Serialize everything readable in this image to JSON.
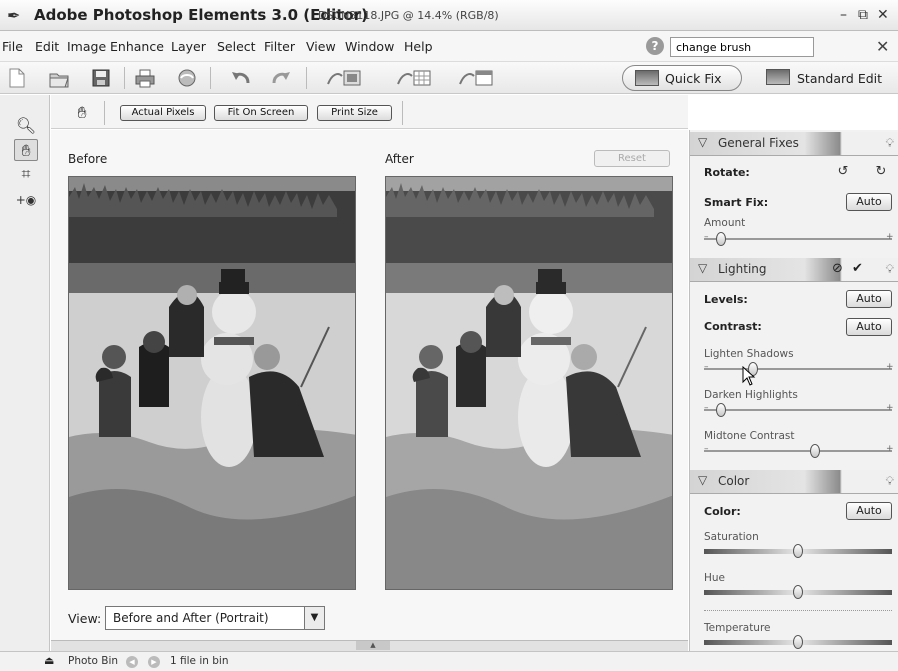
{
  "window": {
    "app_title": "Adobe Photoshop Elements 3.0 (Editor)",
    "doc_title": "DSCN3118.JPG @ 14.4% (RGB/8)"
  },
  "menu": [
    "File",
    "Edit",
    "Image",
    "Enhance",
    "Layer",
    "Select",
    "Filter",
    "View",
    "Window",
    "Help"
  ],
  "help_search": {
    "value": "change brush"
  },
  "modes": {
    "quick_fix": "Quick Fix",
    "standard_edit": "Standard Edit"
  },
  "options": {
    "actual_pixels": "Actual Pixels",
    "fit_on_screen": "Fit On Screen",
    "print_size": "Print Size"
  },
  "canvas": {
    "before_label": "Before",
    "after_label": "After",
    "reset_label": "Reset",
    "view_label": "View:",
    "view_value": "Before and After (Portrait)"
  },
  "palette": {
    "general": {
      "title": "General Fixes",
      "rotate_label": "Rotate:",
      "smart_fix_label": "Smart Fix:",
      "smart_fix_button": "Auto",
      "amount_label": "Amount",
      "amount_value": 0.05
    },
    "lighting": {
      "title": "Lighting",
      "levels_label": "Levels:",
      "levels_button": "Auto",
      "contrast_label": "Contrast:",
      "contrast_button": "Auto",
      "lighten_shadows_label": "Lighten Shadows",
      "lighten_shadows_value": 0.24,
      "darken_highlights_label": "Darken Highlights",
      "darken_highlights_value": 0.05,
      "midtone_contrast_label": "Midtone Contrast",
      "midtone_contrast_value": 0.6
    },
    "color": {
      "title": "Color",
      "color_label": "Color:",
      "color_button": "Auto",
      "saturation_label": "Saturation",
      "saturation_value": 0.5,
      "hue_label": "Hue",
      "hue_value": 0.5,
      "temperature_label": "Temperature",
      "temperature_value": 0.5
    }
  },
  "status": {
    "photo_bin_label": "Photo Bin",
    "file_count": "1 file in bin"
  }
}
